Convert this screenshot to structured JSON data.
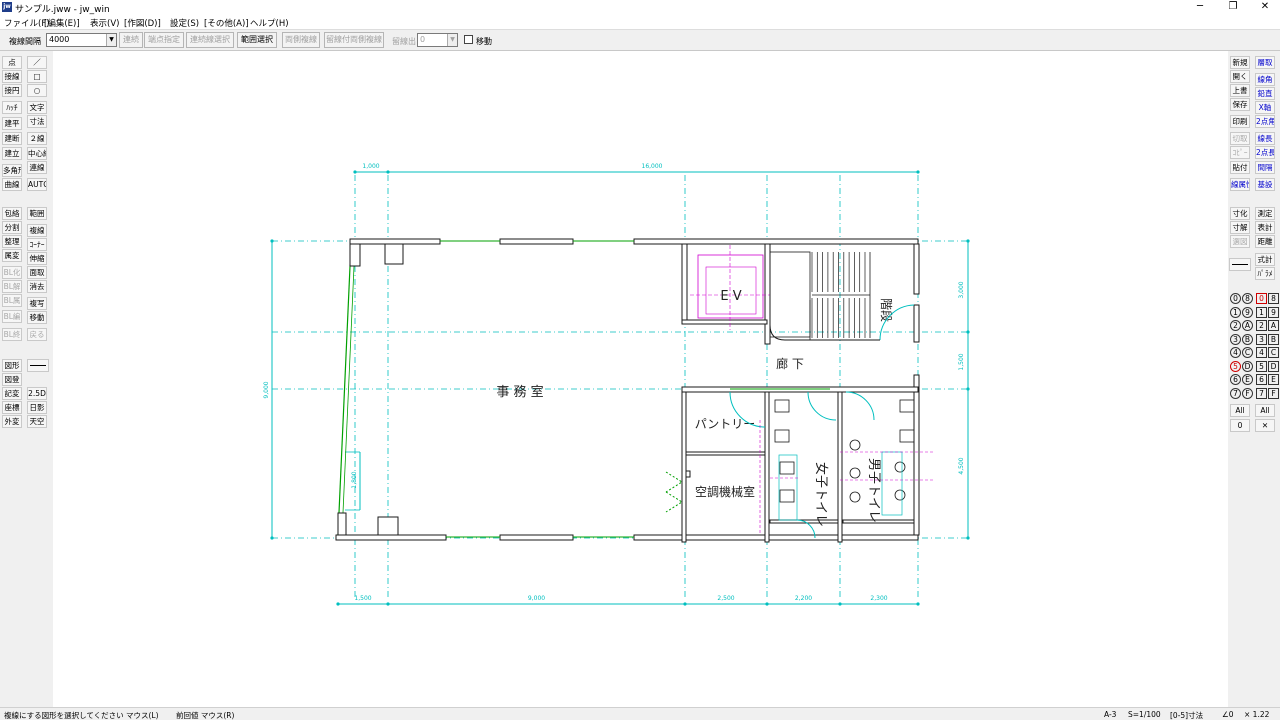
{
  "window": {
    "title": "サンプル.jww - jw_win",
    "icon": "jw-app-icon",
    "minimize": "─",
    "restore": "❐",
    "close": "✕"
  },
  "menu": [
    "ファイル(F)",
    "[編集(E)]",
    "表示(V)",
    "[作図(D)]",
    "設定(S)",
    "[その他(A)]",
    "ヘルプ(H)"
  ],
  "toolbar": {
    "spacing_label": "複線間隔",
    "spacing_value": "4000",
    "buttons": [
      "連続",
      "端点指定",
      "連続線選択",
      "範囲選択",
      "両側複線",
      "留線付両側複線",
      "留線出"
    ],
    "offset_value": "0",
    "move_label": "移動"
  },
  "left_panel": {
    "col1": [
      "点",
      "接線",
      "接円",
      "ﾊｯﾁ",
      "建平",
      "建断",
      "建立",
      "多角形",
      "曲線",
      "包絡",
      "分割",
      "整理",
      "属変",
      "BL化",
      "BL解",
      "BL属",
      "BL編",
      "BL終",
      "図形",
      "図登",
      "記変",
      "座標",
      "外変"
    ],
    "col2": [
      "／",
      "□",
      "○",
      "文字",
      "寸法",
      "２線",
      "中心線",
      "連線",
      "AUTO",
      "範囲",
      "複線",
      "ｺｰﾅｰ",
      "伸縮",
      "面取",
      "消去",
      "複写",
      "移動",
      "戻る",
      "",
      "2.5D",
      "日影",
      "天空"
    ]
  },
  "right_panel": {
    "col1": [
      "新規",
      "開く",
      "上書",
      "保存",
      "印刷",
      "切取",
      "ｺﾋﾟｰ",
      "貼付",
      "線属性",
      "寸化",
      "寸解",
      "選図",
      "",
      "All",
      "0"
    ],
    "col2": [
      "層取",
      "線角",
      "鉛直",
      "X軸",
      "2点角",
      "線長",
      "2点長",
      "間隔",
      "基設",
      "測定",
      "表計",
      "距離",
      "式計",
      "ﾊﾟﾗﾒ",
      "All",
      "✕"
    ],
    "group_layers": [
      "0",
      "1",
      "2",
      "3",
      "4",
      "5",
      "6",
      "7"
    ],
    "group_layers2": [
      "8",
      "9",
      "A",
      "B",
      "C",
      "D",
      "E",
      "F"
    ],
    "layers": [
      "0",
      "1",
      "2",
      "3",
      "4",
      "5",
      "6",
      "7"
    ],
    "layers2": [
      "8",
      "9",
      "A",
      "B",
      "C",
      "D",
      "E",
      "F"
    ],
    "current_layer": "0"
  },
  "drawing": {
    "dims_top": [
      "1,000",
      "16,000"
    ],
    "dims_bottom": [
      "1,500",
      "9,000",
      "2,500",
      "2,200",
      "2,300"
    ],
    "dims_left": [
      "9,000",
      "1,800"
    ],
    "dims_right": [
      "3,000",
      "1,500",
      "4,500"
    ],
    "rooms": {
      "office": "事 務 室",
      "corridor": "廊 下",
      "elevator": "E V",
      "stairs": "階段",
      "pantry": "パントリー",
      "machine": "空調機械室",
      "women": "女子トイレ",
      "men": "男子トイレ"
    }
  },
  "status": {
    "message": "複線にする図形を選択してください マウス(L)",
    "prev": "前回値 マウス(R)",
    "paper": "A-3",
    "scale": "S=1/100",
    "layer_info": "[0-5]寸法",
    "angle": "∠0",
    "zoom": "× 1.22"
  },
  "colors": {
    "dim_cyan": "#00bfbf",
    "wall": "#1a1a1a",
    "green": "#00a000",
    "magenta": "#d000d0",
    "blue_text": "#0000cc"
  }
}
